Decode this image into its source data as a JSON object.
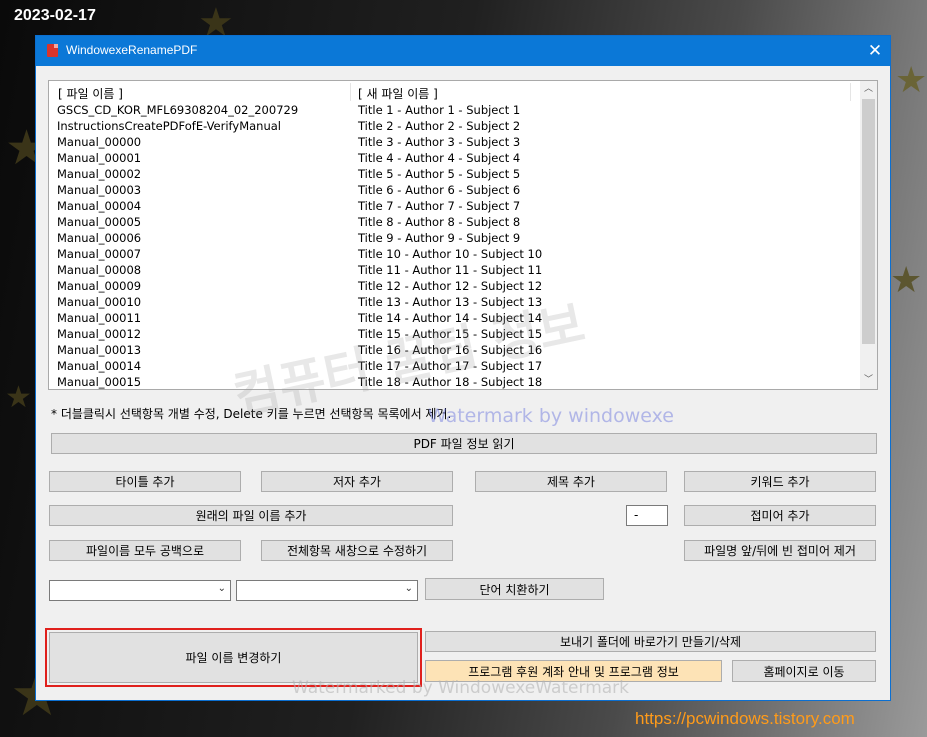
{
  "desktop": {
    "date": "2023-02-17",
    "url": "https://pcwindows.tistory.com"
  },
  "window": {
    "title": "WindowexeRenamePDF",
    "close_symbol": "✕"
  },
  "list": {
    "col_original": "[ 파일 이름 ]",
    "col_new": "[ 새 파일 이름 ]",
    "rows": [
      {
        "orig": "GSCS_CD_KOR_MFL69308204_02_200729",
        "new": "Title 1 - Author 1 - Subject 1"
      },
      {
        "orig": "InstructionsCreatePDFofE-VerifyManual",
        "new": "Title 2 - Author 2 - Subject 2"
      },
      {
        "orig": "Manual_00000",
        "new": "Title 3 - Author 3 - Subject 3"
      },
      {
        "orig": "Manual_00001",
        "new": "Title 4 - Author 4 - Subject 4"
      },
      {
        "orig": "Manual_00002",
        "new": "Title 5 - Author 5 - Subject 5"
      },
      {
        "orig": "Manual_00003",
        "new": "Title 6 - Author 6 - Subject 6"
      },
      {
        "orig": "Manual_00004",
        "new": "Title 7 - Author 7 - Subject 7"
      },
      {
        "orig": "Manual_00005",
        "new": "Title 8 - Author 8 - Subject 8"
      },
      {
        "orig": "Manual_00006",
        "new": "Title 9 - Author 9 - Subject 9"
      },
      {
        "orig": "Manual_00007",
        "new": "Title 10 - Author 10 - Subject 10"
      },
      {
        "orig": "Manual_00008",
        "new": "Title 11 - Author 11 - Subject 11"
      },
      {
        "orig": "Manual_00009",
        "new": "Title 12 - Author 12 - Subject 12"
      },
      {
        "orig": "Manual_00010",
        "new": "Title 13 - Author 13 - Subject 13"
      },
      {
        "orig": "Manual_00011",
        "new": "Title 14 - Author 14 - Subject 14"
      },
      {
        "orig": "Manual_00012",
        "new": "Title 15 - Author 15 - Subject 15"
      },
      {
        "orig": "Manual_00013",
        "new": "Title 16 - Author 16 - Subject 16"
      },
      {
        "orig": "Manual_00014",
        "new": "Title 17 - Author 17 - Subject 17"
      },
      {
        "orig": "Manual_00015",
        "new": "Title 18 - Author 18 - Subject 18"
      }
    ]
  },
  "hint": "* 더블클릭시 선택항목 개별 수정, Delete 키를 누르면 선택항목 목록에서 제거.",
  "buttons": {
    "read_pdf_info": "PDF 파일 정보 읽기",
    "add_title": "타이틀 추가",
    "add_author": "저자 추가",
    "add_subject": "제목 추가",
    "add_keyword": "키워드 추가",
    "add_original_name": "원래의 파일 이름 추가",
    "add_suffix": "접미어 추가",
    "blank_all": "파일이름 모두 공백으로",
    "edit_all_new": "전체항목 새창으로 수정하기",
    "remove_empty_affix": "파일명 앞/뒤에 빈 접미어 제거",
    "replace_word": "단어 치환하기",
    "rename_files": "파일 이름 변경하기",
    "shortcut_export": "보내기 폴더에 바로가기 만들기/삭제",
    "program_info": "프로그램 후원 계좌 안내 및 프로그램 정보",
    "go_homepage": "홈페이지로 이동"
  },
  "suffix_field": {
    "value": "-"
  },
  "combo1": {
    "value": ""
  },
  "combo2": {
    "value": ""
  },
  "watermarks": {
    "big": "컴퓨터 꿀팁 정보",
    "mid": "Watermark by windowexe",
    "bottom": "Watermarked by WindowexeWatermark"
  },
  "colors": {
    "titlebar": "#0b78d7",
    "highlight_frame": "#e0201c",
    "peach_button": "#fde3b6",
    "url_text": "#ff9b1a"
  },
  "icons": {
    "app": "pdf-icon",
    "close": "close-icon",
    "scroll_up": "chevron-up-icon",
    "scroll_down": "chevron-down-icon",
    "combo": "chevron-down-icon"
  }
}
